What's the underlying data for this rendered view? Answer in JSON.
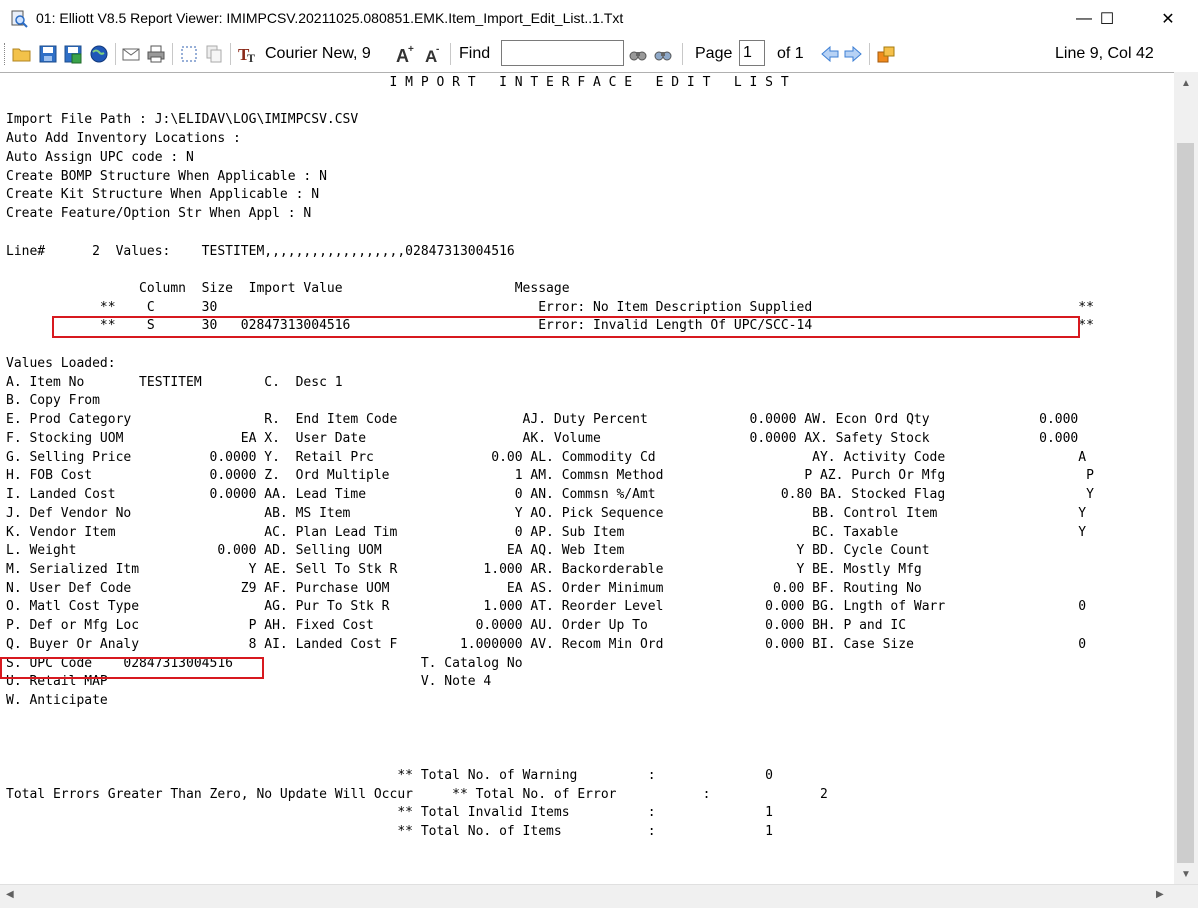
{
  "window": {
    "title": "01: Elliott V8.5 Report Viewer: IMIMPCSV.20211025.080851.EMK.Item_Import_Edit_List..1.Txt",
    "minimize": "—",
    "maximize": "☐",
    "close": "✕"
  },
  "toolbar": {
    "font_label": "Courier New, 9",
    "find_label": "Find",
    "find_value": "",
    "page_label": "Page",
    "page_value": "1",
    "of_label": "of 1",
    "cursor_pos": "Line 9, Col 42",
    "icons": [
      "open-folder-icon",
      "save-icon",
      "save-as-icon",
      "globe-icon",
      "email-icon",
      "print-icon",
      "select-icon",
      "copy-icon",
      "font-icon",
      "font-larger-icon",
      "font-smaller-icon",
      "find-prev-icon",
      "find-next-icon",
      "page-prev-icon",
      "page-next-icon",
      "export-icon"
    ]
  },
  "report": {
    "lines": [
      "                                                 I M P O R T   I N T E R F A C E   E D I T   L I S T",
      "",
      "Import File Path : J:\\ELIDAV\\LOG\\IMIMPCSV.CSV",
      "Auto Add Inventory Locations :",
      "Auto Assign UPC code : N",
      "Create BOMP Structure When Applicable : N",
      "Create Kit Structure When Applicable : N",
      "Create Feature/Option Str When Appl : N",
      "",
      "Line#      2  Values:    TESTITEM,,,,,,,,,,,,,,,,,,02847313004516",
      "",
      "                 Column  Size  Import Value                      Message",
      "            **    C      30                                         Error: No Item Description Supplied                                  **",
      "            **    S      30   02847313004516                        Error: Invalid Length Of UPC/SCC-14                                  **",
      "",
      "Values Loaded:",
      "A. Item No       TESTITEM        C.  Desc 1",
      "B. Copy From",
      "E. Prod Category                 R.  End Item Code                AJ. Duty Percent             0.0000 AW. Econ Ord Qty              0.000",
      "F. Stocking UOM               EA X.  User Date                    AK. Volume                   0.0000 AX. Safety Stock              0.000",
      "G. Selling Price          0.0000 Y.  Retail Prc               0.00 AL. Commodity Cd                    AY. Activity Code                 A",
      "H. FOB Cost               0.0000 Z.  Ord Multiple                1 AM. Commsn Method                  P AZ. Purch Or Mfg                  P",
      "I. Landed Cost            0.0000 AA. Lead Time                   0 AN. Commsn %/Amt                0.80 BA. Stocked Flag                  Y",
      "J. Def Vendor No                 AB. MS Item                     Y AO. Pick Sequence                   BB. Control Item                  Y",
      "K. Vendor Item                   AC. Plan Lead Tim               0 AP. Sub Item                        BC. Taxable                       Y",
      "L. Weight                  0.000 AD. Selling UOM                EA AQ. Web Item                      Y BD. Cycle Count",
      "M. Serialized Itm              Y AE. Sell To Stk R           1.000 AR. Backorderable                 Y BE. Mostly Mfg",
      "N. User Def Code              Z9 AF. Purchase UOM               EA AS. Order Minimum              0.00 BF. Routing No",
      "O. Matl Cost Type                AG. Pur To Stk R            1.000 AT. Reorder Level             0.000 BG. Lngth of Warr                 0",
      "P. Def or Mfg Loc              P AH. Fixed Cost             0.0000 AU. Order Up To               0.000 BH. P and IC",
      "Q. Buyer Or Analy              8 AI. Landed Cost F        1.000000 AV. Recom Min Ord             0.000 BI. Case Size                     0",
      "S. UPC Code    02847313004516                        T. Catalog No",
      "U. Retail MAP                                        V. Note 4",
      "W. Anticipate",
      "",
      "",
      "",
      "                                                  ** Total No. of Warning         :              0",
      "Total Errors Greater Than Zero, No Update Will Occur     ** Total No. of Error           :              2",
      "                                                  ** Total Invalid Items          :              1",
      "                                                  ** Total No. of Items           :              1"
    ]
  },
  "colors": {
    "highlight_box": "#d7191f",
    "titlebar_bg": "#ffffff",
    "content_bg": "#ffffff"
  }
}
